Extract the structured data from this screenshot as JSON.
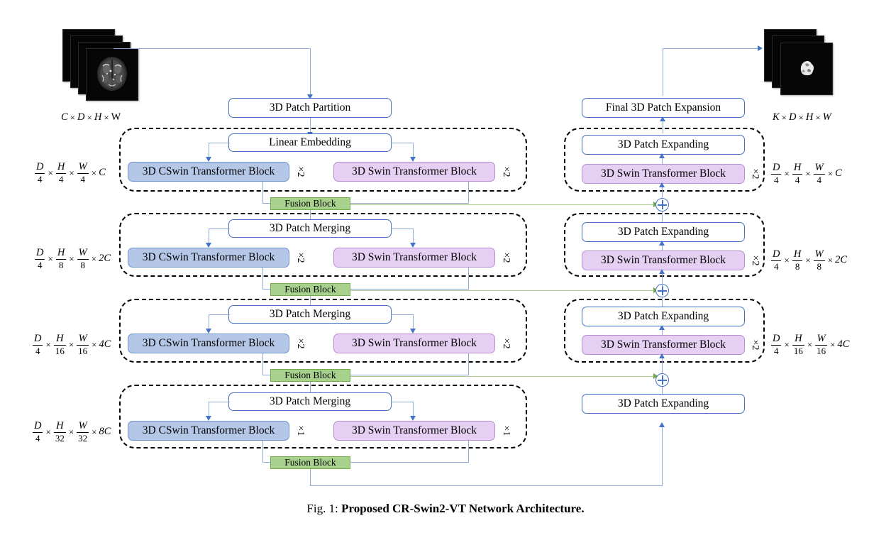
{
  "figure": {
    "caption_lead": "Fig. 1:",
    "caption_title": "Proposed CR-Swin2-VT Network Architecture."
  },
  "input": {
    "name": "input-volume-stack",
    "label_parts": [
      "C",
      "D",
      "H",
      "W"
    ],
    "label": "C × D × H ×W",
    "slice_count": 4
  },
  "output": {
    "name": "output-segmentation-stack",
    "label": "K × D × H × W",
    "slice_count": 3
  },
  "encoder": {
    "patch_partition": "3D Patch Partition",
    "stages": [
      {
        "head": "Linear Embedding",
        "cswin": "3D CSwin Transformer Block",
        "swin": "3D Swin Transformer Block",
        "cswin_mult": "×2",
        "swin_mult": "×2",
        "fusion": "Fusion Block",
        "dim": "D/4 × H/4 × W/4 × C",
        "dim_parts": {
          "n1": "D",
          "d1": "4",
          "n2": "H",
          "d2": "4",
          "n3": "W",
          "d3": "4",
          "ch": "C"
        }
      },
      {
        "head": "3D Patch Merging",
        "cswin": "3D CSwin Transformer Block",
        "swin": "3D Swin Transformer Block",
        "cswin_mult": "×2",
        "swin_mult": "×2",
        "fusion": "Fusion Block",
        "dim": "D/4 × H/8 × W/8 × 2C",
        "dim_parts": {
          "n1": "D",
          "d1": "4",
          "n2": "H",
          "d2": "8",
          "n3": "W",
          "d3": "8",
          "ch": "2C"
        }
      },
      {
        "head": "3D Patch Merging",
        "cswin": "3D CSwin Transformer Block",
        "swin": "3D Swin Transformer Block",
        "cswin_mult": "×2",
        "swin_mult": "×2",
        "fusion": "Fusion Block",
        "dim": "D/4 × H/16 × W/16 × 4C",
        "dim_parts": {
          "n1": "D",
          "d1": "4",
          "n2": "H",
          "d2": "16",
          "n3": "W",
          "d3": "16",
          "ch": "4C"
        }
      },
      {
        "head": "3D Patch Merging",
        "cswin": "3D CSwin Transformer Block",
        "swin": "3D Swin Transformer Block",
        "cswin_mult": "×1",
        "swin_mult": "×1",
        "fusion": "Fusion Block",
        "dim": "D/4 × H/32 × W/32 × 8C",
        "dim_parts": {
          "n1": "D",
          "d1": "4",
          "n2": "H",
          "d2": "32",
          "n3": "W",
          "d3": "32",
          "ch": "8C"
        }
      }
    ]
  },
  "decoder": {
    "final_expansion": "Final 3D Patch Expansion",
    "stages": [
      {
        "expanding": "3D Patch Expanding",
        "swin": "3D Swin Transformer Block",
        "swin_mult": "×2",
        "dim": "D/4 × H/4 × W/4 × C",
        "dim_parts": {
          "n1": "D",
          "d1": "4",
          "n2": "H",
          "d2": "4",
          "n3": "W",
          "d3": "4",
          "ch": "C"
        }
      },
      {
        "expanding": "3D Patch Expanding",
        "swin": "3D Swin Transformer Block",
        "swin_mult": "×2",
        "dim": "D/4 × H/8 × W/8 × 2C",
        "dim_parts": {
          "n1": "D",
          "d1": "4",
          "n2": "H",
          "d2": "8",
          "n3": "W",
          "d3": "8",
          "ch": "2C"
        }
      },
      {
        "expanding": "3D Patch Expanding",
        "swin": "3D Swin Transformer Block",
        "swin_mult": "×2",
        "dim": "D/4 × H/16 × W/16 × 4C",
        "dim_parts": {
          "n1": "D",
          "d1": "4",
          "n2": "H",
          "d2": "16",
          "n3": "W",
          "d3": "16",
          "ch": "4C"
        }
      },
      {
        "expanding": "3D Patch Expanding",
        "swin": null,
        "swin_mult": null,
        "dim": null,
        "dim_parts": null
      }
    ],
    "skip_node_symbol": "⊕"
  },
  "colors": {
    "cswin_fill": "#b4c7e7",
    "cswin_border": "#6f94cd",
    "swin_fill": "#e5cff2",
    "swin_border": "#b98fd4",
    "fusion_fill": "#a9d18e",
    "fusion_border": "#70ad47",
    "box_border": "#4472c4",
    "connector": "#8faadc",
    "skip_connector": "#a9d18e",
    "stage_border": "#000000"
  }
}
